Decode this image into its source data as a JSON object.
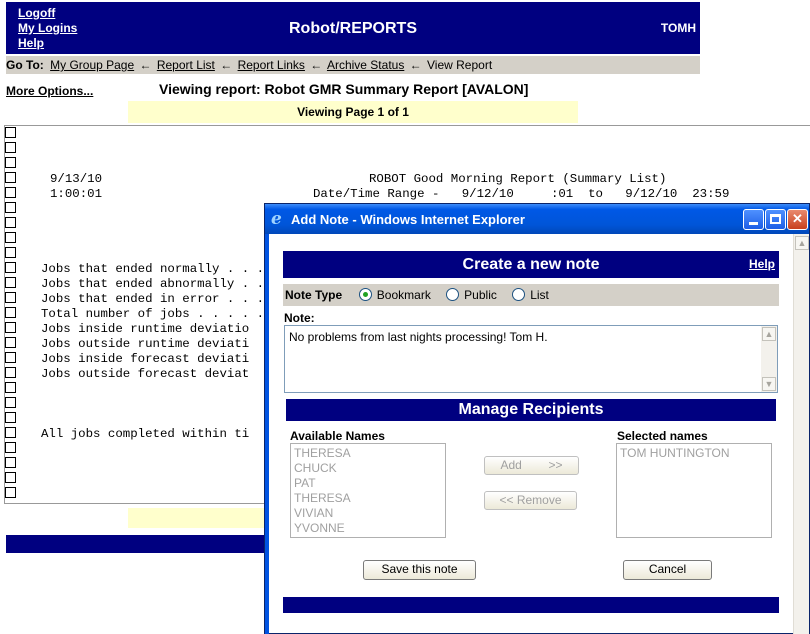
{
  "header": {
    "links": [
      "Logoff",
      "My Logins",
      "Help"
    ],
    "app_title": "Robot/REPORTS",
    "user": "TOMH"
  },
  "goto": {
    "label": "Go To:",
    "links": [
      "My Group Page",
      "Report List",
      "Report Links",
      "Archive Status"
    ],
    "current": "View Report"
  },
  "more_options": "More Options...",
  "viewing_title": "Viewing report: Robot GMR Summary Report [AVALON]",
  "page_indicator": {
    "prefix": "Viewing Page",
    "current": "1",
    "of": "of",
    "total": "1"
  },
  "report_lines": {
    "date": "9/13/10",
    "time": "1:00:01",
    "title": "ROBOT Good Morning Report (Summary List)",
    "range": "Date/Time Range -   9/12/10     :01  to   9/12/10  23:59",
    "rows": [
      "Jobs that ended normally . . .",
      "Jobs that ended abnormally . .",
      "Jobs that ended in error . . .",
      "Total number of jobs . . . . .",
      "Jobs inside runtime deviatio",
      "Jobs outside runtime deviati",
      "Jobs inside forecast deviati",
      "Jobs outside forecast deviat"
    ],
    "completed": "All jobs completed within ti"
  },
  "dialog": {
    "title": "Add Note - Windows Internet Explorer",
    "header": "Create a new note",
    "help": "Help",
    "note_type_label": "Note Type",
    "note_types": [
      "Bookmark",
      "Public",
      "List"
    ],
    "selected_type": "Bookmark",
    "note_label": "Note:",
    "note_text": "No problems from last nights processing!  Tom H.",
    "recipients_header": "Manage Recipients",
    "available_label": "Available Names",
    "available": [
      "THERESA",
      "CHUCK",
      "PAT",
      "THERESA",
      "VIVIAN",
      "YVONNE"
    ],
    "selected_label": "Selected names",
    "selected": [
      "TOM HUNTINGTON"
    ],
    "add_label": "Add        >>",
    "remove_label": "<< Remove",
    "save_label": "Save this note",
    "cancel_label": "Cancel"
  }
}
